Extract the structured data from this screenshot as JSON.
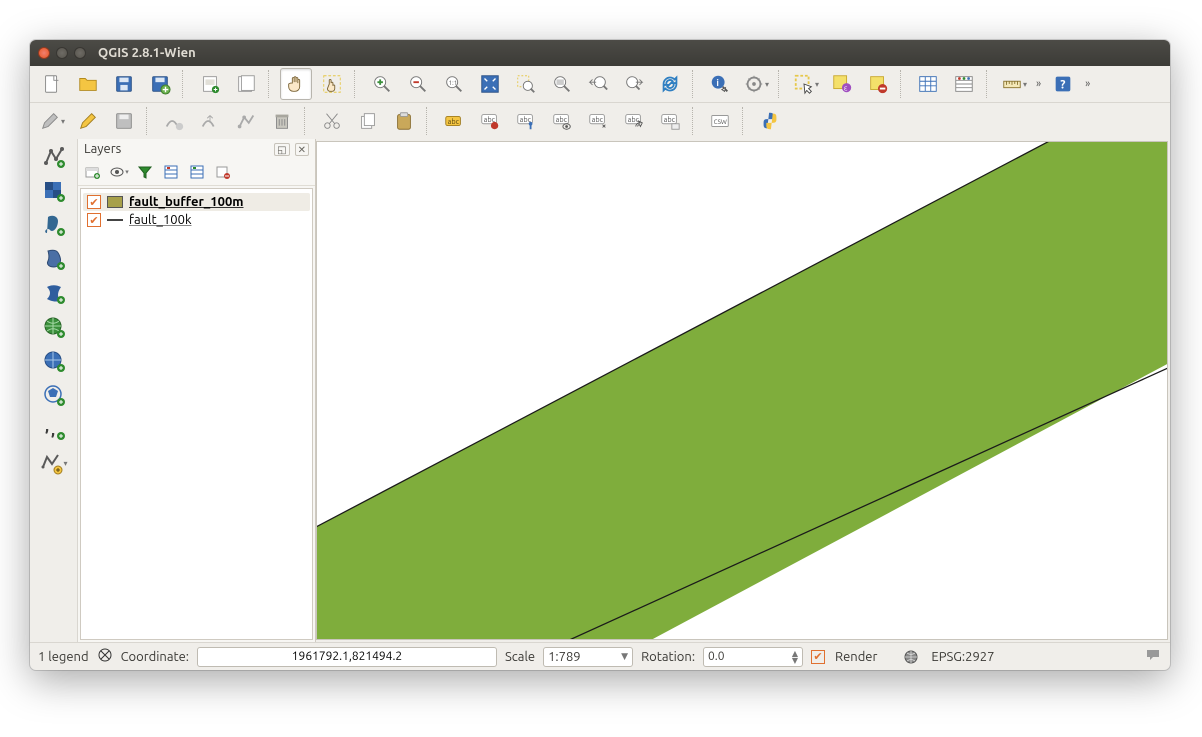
{
  "window": {
    "title": "QGIS 2.8.1-Wien"
  },
  "layers_panel": {
    "title": "Layers",
    "items": [
      {
        "name": "fault_buffer_100m",
        "type": "polygon",
        "checked": true,
        "selected": true
      },
      {
        "name": "fault_100k",
        "type": "line",
        "checked": true,
        "selected": false
      }
    ]
  },
  "statusbar": {
    "legend_hint": "1 legend",
    "coord_label": "Coordinate:",
    "coord_value": "1961792.1,821494.2",
    "scale_label": "Scale",
    "scale_value": "1:789",
    "rotation_label": "Rotation:",
    "rotation_value": "0.0",
    "render_label": "Render",
    "crs_label": "EPSG:2927"
  },
  "canvas": {
    "feature_fill": "#7fad3c",
    "feature_stroke": "#1a1a1a"
  }
}
